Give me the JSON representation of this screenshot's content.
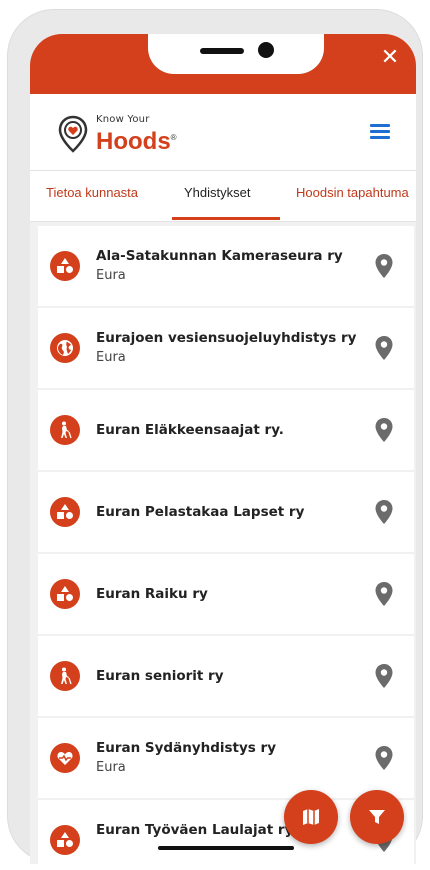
{
  "app": {
    "brand_small": "Know Your",
    "brand_big": "Hoods",
    "brand_mark": "®"
  },
  "tabs": [
    {
      "label": "Tietoa kunnasta",
      "active": false
    },
    {
      "label": "Yhdistykset",
      "active": true
    },
    {
      "label": "Hoodsin tapahtuma",
      "active": false
    }
  ],
  "associations": [
    {
      "name": "Ala-Satakunnan Kameraseura ry",
      "location": "Eura",
      "icon": "shapes-icon"
    },
    {
      "name": "Eurajoen vesiensuojeluyhdistys ry",
      "location": "Eura",
      "icon": "globe-icon"
    },
    {
      "name": "Euran Eläkkeensaajat ry.",
      "location": "",
      "icon": "elderly-walker-icon"
    },
    {
      "name": "Euran Pelastakaa Lapset ry",
      "location": "",
      "icon": "shapes-icon"
    },
    {
      "name": "Euran Raiku ry",
      "location": "",
      "icon": "shapes-icon"
    },
    {
      "name": "Euran seniorit ry",
      "location": "",
      "icon": "elderly-walker-icon"
    },
    {
      "name": "Euran Sydänyhdistys ry",
      "location": "Eura",
      "icon": "heart-pulse-icon"
    },
    {
      "name": "Euran Työväen Laulajat ry/",
      "location": "",
      "icon": "shapes-icon"
    }
  ],
  "colors": {
    "accent": "#d3401b",
    "menu": "#1f6fd1",
    "pin": "#6b6b6b"
  },
  "icons": {
    "close": "close-icon",
    "menu": "hamburger-menu-icon",
    "map_fab": "map-icon",
    "filter_fab": "filter-icon",
    "location": "map-pin-icon"
  },
  "close_glyph": "✕"
}
